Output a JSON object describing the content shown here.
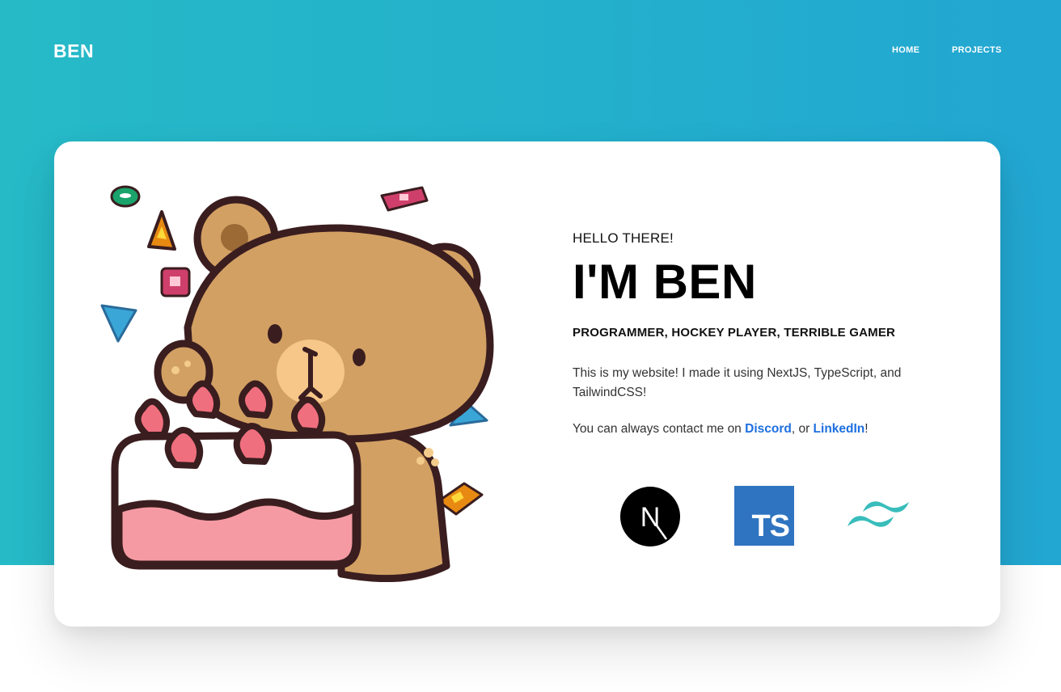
{
  "header": {
    "brand": "BEN",
    "nav": [
      {
        "label": "HOME"
      },
      {
        "label": "PROJECTS"
      }
    ]
  },
  "hero": {
    "greeting": "HELLO THERE!",
    "headline": "I'M BEN",
    "subtitle": "PROGRAMMER, HOCKEY PLAYER, TERRIBLE GAMER",
    "bio": "This is my website! I made it using NextJS, TypeScript, and TailwindCSS!",
    "contact": {
      "prefix": "You can always contact me on ",
      "discord_label": "Discord",
      "middle": ", or ",
      "linkedin_label": "LinkedIn",
      "suffix": "!"
    },
    "tech_logos": [
      {
        "icon": "nextjs-logo-icon",
        "text": "N"
      },
      {
        "icon": "typescript-logo-icon",
        "text": "TS"
      },
      {
        "icon": "tailwindcss-logo-icon"
      }
    ],
    "illustration_icon": "bear-with-cake-illustration"
  },
  "colors": {
    "hero_gradient_start": "#26bac7",
    "hero_gradient_end": "#22a6d2",
    "link": "#1d6fe0",
    "typescript_blue": "#2f74c0",
    "tailwind_teal": "#38bdbb"
  }
}
